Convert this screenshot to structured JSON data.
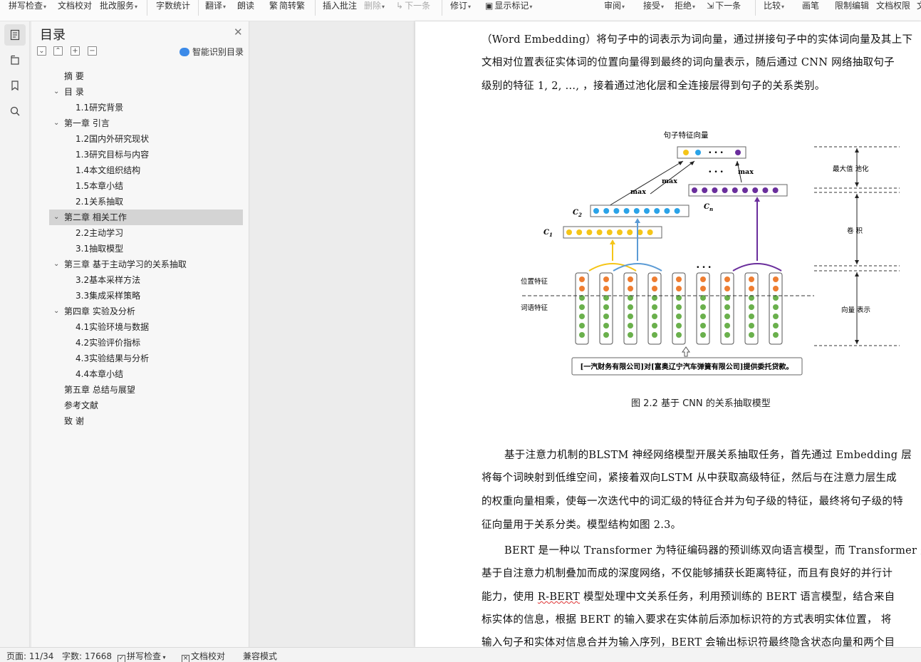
{
  "ribbon": {
    "spell_check": "拼写检查",
    "doc_proof": "文档校对",
    "batch_service": "批改服务",
    "word_count": "字数统计",
    "translate": "翻译",
    "read_aloud": "朗读",
    "simp_trad": "简转繁",
    "insert_comment": "插入批注",
    "delete": "删除",
    "next_prev": "下一条",
    "revise": "修订",
    "show_markup": "显示标记",
    "review": "审阅",
    "accept": "接受",
    "reject": "拒绝",
    "next": "下一条",
    "compare": "比较",
    "ink": "画笔",
    "restrict_edit": "限制编辑",
    "doc_permission": "文档权限",
    "more": "文"
  },
  "toc": {
    "title": "目录",
    "smart_label": "智能识别目录",
    "items": [
      {
        "label": "摘  要",
        "level": 1,
        "expandable": false,
        "selected": false
      },
      {
        "label": "目  录",
        "level": 1,
        "expandable": true,
        "selected": false
      },
      {
        "label": "1.1研究背景",
        "level": 2,
        "expandable": false,
        "selected": false
      },
      {
        "label": "第一章  引言",
        "level": 1,
        "expandable": true,
        "selected": false
      },
      {
        "label": "1.2国内外研究现状",
        "level": 2,
        "expandable": false,
        "selected": false
      },
      {
        "label": "1.3研究目标与内容",
        "level": 2,
        "expandable": false,
        "selected": false
      },
      {
        "label": "1.4本文组织结构",
        "level": 2,
        "expandable": false,
        "selected": false
      },
      {
        "label": "1.5本章小结",
        "level": 2,
        "expandable": false,
        "selected": false
      },
      {
        "label": "2.1关系抽取",
        "level": 2,
        "expandable": false,
        "selected": false
      },
      {
        "label": "第二章  相关工作",
        "level": 1,
        "expandable": true,
        "selected": true
      },
      {
        "label": "2.2主动学习",
        "level": 2,
        "expandable": false,
        "selected": false
      },
      {
        "label": "3.1抽取模型",
        "level": 2,
        "expandable": false,
        "selected": false
      },
      {
        "label": "第三章  基于主动学习的关系抽取",
        "level": 1,
        "expandable": true,
        "selected": false
      },
      {
        "label": "3.2基本采样方法",
        "level": 2,
        "expandable": false,
        "selected": false
      },
      {
        "label": "3.3集成采样策略",
        "level": 2,
        "expandable": false,
        "selected": false
      },
      {
        "label": "第四章  实验及分析",
        "level": 1,
        "expandable": true,
        "selected": false
      },
      {
        "label": "4.1实验环境与数据",
        "level": 2,
        "expandable": false,
        "selected": false
      },
      {
        "label": "4.2实验评价指标",
        "level": 2,
        "expandable": false,
        "selected": false
      },
      {
        "label": "4.3实验结果与分析",
        "level": 2,
        "expandable": false,
        "selected": false
      },
      {
        "label": "4.4本章小结",
        "level": 2,
        "expandable": false,
        "selected": false
      },
      {
        "label": "第五章  总结与展望",
        "level": 1,
        "expandable": false,
        "selected": false
      },
      {
        "label": "参考文献",
        "level": 1,
        "expandable": false,
        "selected": false
      },
      {
        "label": "致  谢",
        "level": 1,
        "expandable": false,
        "selected": false
      }
    ]
  },
  "document": {
    "lines_top": [
      "（Word Embedding）将句子中的词表示为词向量，通过拼接句子中的实体词向量及其上下",
      "文相对位置表征实体词的位置向量得到最终的词向量表示，随后通过  CNN 网络抽取句子",
      "级别的特征      1,      2, ..., ",
      "，接着通过池化层和全连接层得到句子的关系类别。"
    ],
    "figure": {
      "sentence_vector": "句子特征向量",
      "max_label": "max",
      "c1": "C",
      "c1_sub": "1",
      "c2": "C",
      "c2_sub": "2",
      "cn": "C",
      "cn_sub": "n",
      "ellipsis": "• • •",
      "pos_feature": "位置特征",
      "word_feature": "词语特征",
      "sentence": "[一汽财务有限公司]对[富奥辽宁汽车弹簧有限公司]提供委托贷款。",
      "max_pool": "最大值  池化",
      "conv": "卷    积",
      "vec_rep": "向量  表示"
    },
    "caption": "图  2.2 基于  CNN 的关系抽取模型",
    "lines_bottom": [
      "基于注意力机制的BLSTM 神经网络模型开展关系抽取任务，首先通过  Embedding 层",
      "将每个词映射到低维空间，紧接着双向LSTM 从中获取高级特征，然后与在注意力层生成",
      "的权重向量相乘，使每一次迭代中的词汇级的特征合并为句子级的特征，最终将句子级的特",
      "征向量用于关系分类。模型结构如图  2.3。",
      "BERT 是一种以  Transformer 为特征编码器的预训练双向语言模型，而  Transformer 是",
      "基于自注意力机制叠加而成的深度网络，不仅能够捕获长距离特征，而且有良好的并行计",
      "能力，使用  ",
      "R-BERT",
      " 模型处理中文关系任务，利用预训练的  BERT 语言模型，结合来自",
      "标实体的信息，根据  BERT 的输入要求在实体前后添加标识符的方式表明实体位置，  将",
      "输入句子和实体对信息合并为输入序列，BERT 会输出标识符最终隐含状态向量和两个目"
    ]
  },
  "status": {
    "page": "页面: 11/34",
    "words": "字数: 17668",
    "spell": "拼写检查",
    "proof": "文档校对",
    "compat": "兼容模式"
  },
  "colors": {
    "yellow": "#f5c518",
    "blue": "#2aa3e8",
    "purple": "#6a2e9c",
    "orange": "#ee7d31",
    "green": "#6ab04c",
    "selected_bg": "#d4d4d4"
  }
}
